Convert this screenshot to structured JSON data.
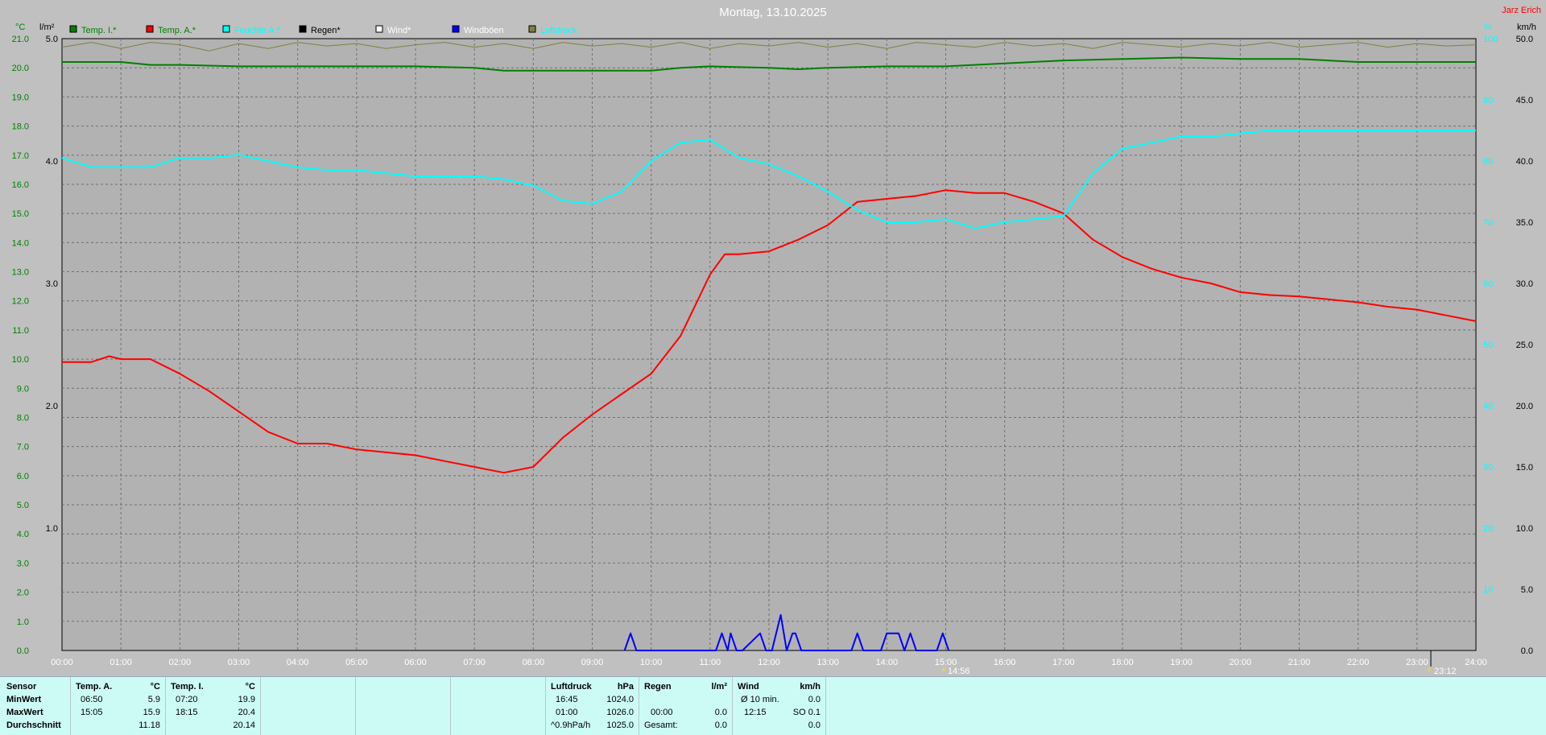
{
  "header": {
    "title": "Montag, 13.10.2025",
    "station": "Jarz Erich",
    "unit_temp": "°C",
    "unit_rain": "l/m²",
    "unit_humidity": "%",
    "unit_wind": "km/h",
    "marker_left": "14:56",
    "marker_right": "23:12"
  },
  "legend": [
    {
      "label": "Temp. I.*",
      "color": "#008000",
      "text_color": "#008000"
    },
    {
      "label": "Temp. A.*",
      "color": "#ff0000",
      "text_color": "#008000"
    },
    {
      "label": "Feuchte A.*",
      "color": "#00ffff",
      "text_color": "#00ffff"
    },
    {
      "label": "Regen*",
      "color": "#000000",
      "text_color": "#000000"
    },
    {
      "label": "Wind*",
      "color": "#ffffff",
      "text_color": "#ffffff"
    },
    {
      "label": "Windböen",
      "color": "#0000ff",
      "text_color": "#ffffff"
    },
    {
      "label": "Luftdruck",
      "color": "#808040",
      "text_color": "#00ffff"
    }
  ],
  "colors": {
    "background": "#c0c0c0",
    "plot_bg": "#b2b2b2",
    "temp_axis": "#008000",
    "humidity_axis": "#00ffff",
    "station_name": "#ff0000",
    "summary_bg": "#ccfbf6"
  },
  "chart_data": {
    "type": "line",
    "title": "Montag, 13.10.2025",
    "x_ticks": [
      "00:00",
      "01:00",
      "02:00",
      "03:00",
      "04:00",
      "05:00",
      "06:00",
      "07:00",
      "08:00",
      "09:00",
      "10:00",
      "11:00",
      "12:00",
      "13:00",
      "14:00",
      "15:00",
      "16:00",
      "17:00",
      "18:00",
      "19:00",
      "20:00",
      "21:00",
      "22:00",
      "23:00",
      "24:00"
    ],
    "xlim": [
      0,
      24
    ],
    "axes": {
      "temp": {
        "range": [
          0,
          21
        ],
        "ticks": [
          "0.0",
          "1.0",
          "2.0",
          "3.0",
          "4.0",
          "5.0",
          "6.0",
          "7.0",
          "8.0",
          "9.0",
          "10.0",
          "11.0",
          "12.0",
          "13.0",
          "14.0",
          "15.0",
          "16.0",
          "17.0",
          "18.0",
          "19.0",
          "20.0",
          "21.0"
        ]
      },
      "rain": {
        "range": [
          0,
          5
        ],
        "ticks": [
          "1.0",
          "2.0",
          "3.0",
          "4.0",
          "5.0"
        ]
      },
      "humidity": {
        "range": [
          0,
          100
        ],
        "ticks": [
          "10",
          "20",
          "30",
          "40",
          "50",
          "60",
          "70",
          "80",
          "90",
          "100"
        ]
      },
      "wind": {
        "range": [
          0,
          50
        ],
        "ticks": [
          "0.0",
          "5.0",
          "10.0",
          "15.0",
          "20.0",
          "25.0",
          "30.0",
          "35.0",
          "40.0",
          "45.0",
          "50.0"
        ]
      }
    },
    "grid": true,
    "series": [
      {
        "name": "Temp. I.",
        "axis": "temp",
        "color": "#008000",
        "x": [
          0,
          1,
          1.5,
          2,
          3,
          4,
          5,
          6,
          7,
          7.5,
          8,
          9,
          10,
          10.5,
          11,
          12,
          12.5,
          13,
          14,
          15,
          16,
          17,
          18,
          19,
          20,
          21,
          22,
          23,
          24
        ],
        "y": [
          20.2,
          20.2,
          20.1,
          20.1,
          20.05,
          20.05,
          20.05,
          20.05,
          20.0,
          19.9,
          19.9,
          19.9,
          19.9,
          20.0,
          20.05,
          20.0,
          19.95,
          20.0,
          20.05,
          20.05,
          20.15,
          20.25,
          20.3,
          20.35,
          20.3,
          20.3,
          20.2,
          20.2,
          20.2
        ]
      },
      {
        "name": "Temp. A.",
        "axis": "temp",
        "color": "#ff0000",
        "x": [
          0,
          0.5,
          0.8,
          1,
          1.5,
          2,
          2.5,
          3,
          3.5,
          4,
          4.5,
          5,
          5.5,
          6,
          6.5,
          7,
          7.5,
          8,
          8.5,
          9,
          9.5,
          10,
          10.5,
          11,
          11.25,
          11.5,
          12,
          12.5,
          13,
          13.5,
          14,
          14.5,
          15,
          15.5,
          16,
          16.5,
          17,
          17.5,
          18,
          18.5,
          19,
          19.5,
          20,
          20.5,
          21,
          21.5,
          22,
          22.5,
          23,
          23.5,
          24
        ],
        "y": [
          9.9,
          9.9,
          10.1,
          10.0,
          10.0,
          9.5,
          8.9,
          8.2,
          7.5,
          7.1,
          7.1,
          6.9,
          6.8,
          6.7,
          6.5,
          6.3,
          6.1,
          6.3,
          7.3,
          8.1,
          8.8,
          9.5,
          10.8,
          12.9,
          13.6,
          13.6,
          13.7,
          14.1,
          14.6,
          15.4,
          15.5,
          15.6,
          15.8,
          15.7,
          15.7,
          15.4,
          15.0,
          14.1,
          13.5,
          13.1,
          12.8,
          12.6,
          12.3,
          12.2,
          12.15,
          12.05,
          11.95,
          11.8,
          11.7,
          11.5,
          11.3
        ]
      },
      {
        "name": "Feuchte A.",
        "axis": "humidity",
        "color": "#00ffff",
        "x": [
          0,
          0.5,
          1,
          1.5,
          2,
          2.5,
          3,
          3.5,
          4,
          4.5,
          5,
          5.5,
          6,
          6.5,
          7,
          7.5,
          8,
          8.5,
          9,
          9.5,
          10,
          10.5,
          11,
          11.5,
          12,
          12.5,
          13,
          13.5,
          14,
          14.5,
          15,
          15.5,
          16,
          16.5,
          17,
          17.5,
          18,
          18.5,
          19,
          19.5,
          20,
          20.5,
          21,
          21.5,
          22,
          22.5,
          23,
          23.5,
          24
        ],
        "y": [
          80.5,
          79,
          79,
          79,
          80.5,
          80.5,
          81,
          80,
          79,
          78.5,
          78.5,
          78,
          77.5,
          77.5,
          77.5,
          77,
          76,
          73.5,
          73,
          75,
          80,
          83,
          83.5,
          80.5,
          79.5,
          77.5,
          75,
          72,
          70,
          70,
          70.5,
          69,
          70,
          70.5,
          71,
          78,
          82,
          83,
          84,
          84,
          84.5,
          85,
          85,
          85,
          85,
          85,
          85,
          85,
          85
        ]
      },
      {
        "name": "Windböen",
        "axis": "wind",
        "color": "#0000ff",
        "x": [
          9.55,
          9.65,
          9.75,
          11.1,
          11.2,
          11.3,
          11.35,
          11.45,
          11.55,
          11.85,
          11.95,
          12.05,
          12.2,
          12.3,
          12.4,
          12.45,
          12.55,
          12.65,
          13.4,
          13.5,
          13.6,
          13.9,
          14.0,
          14.2,
          14.3,
          14.4,
          14.5,
          14.6,
          14.85,
          14.95,
          15.05
        ],
        "y": [
          0,
          1.4,
          0,
          0,
          1.4,
          0,
          1.4,
          0,
          0,
          1.4,
          0,
          0,
          2.9,
          0,
          1.4,
          1.4,
          0,
          0,
          0,
          1.4,
          0,
          0,
          1.4,
          1.4,
          0,
          1.4,
          0,
          0,
          0,
          1.4,
          0
        ]
      },
      {
        "name": "Luftdruck",
        "axis": "rain",
        "color": "#808040",
        "note_scale": "top band",
        "x": [
          0,
          0.5,
          1,
          1.5,
          2,
          2.5,
          3,
          3.5,
          4,
          4.5,
          5,
          5.5,
          6,
          6.5,
          7,
          7.5,
          8,
          8.5,
          9,
          9.5,
          10,
          10.5,
          11,
          11.5,
          12,
          12.5,
          13,
          13.5,
          14,
          14.5,
          15,
          15.5,
          16,
          16.5,
          17,
          17.5,
          18,
          18.5,
          19,
          19.5,
          20,
          20.5,
          21,
          21.5,
          22,
          22.5,
          23,
          23.5,
          24
        ],
        "y": [
          4.93,
          4.97,
          4.92,
          4.97,
          4.95,
          4.9,
          4.96,
          4.92,
          4.97,
          4.94,
          4.96,
          4.92,
          4.95,
          4.97,
          4.93,
          4.96,
          4.92,
          4.97,
          4.94,
          4.96,
          4.93,
          4.97,
          4.92,
          4.96,
          4.94,
          4.97,
          4.93,
          4.96,
          4.92,
          4.97,
          4.95,
          4.93,
          4.97,
          4.94,
          4.96,
          4.92,
          4.97,
          4.95,
          4.93,
          4.96,
          4.94,
          4.97,
          4.93,
          4.95,
          4.97,
          4.93,
          4.96,
          4.94,
          4.95
        ]
      }
    ]
  },
  "summary": {
    "sensor_label": "Sensor",
    "row_labels": [
      "MinWert",
      "MaxWert",
      "Durchschnitt"
    ],
    "temp_a": {
      "title": "Temp. A.",
      "unit": "°C",
      "rows": [
        [
          "06:50",
          "5.9"
        ],
        [
          "15:05",
          "15.9"
        ],
        [
          "",
          "11.18"
        ]
      ]
    },
    "temp_i": {
      "title": "Temp. I.",
      "unit": "°C",
      "rows": [
        [
          "07:20",
          "19.9"
        ],
        [
          "18:15",
          "20.4"
        ],
        [
          "",
          "20.14"
        ]
      ]
    },
    "pressure": {
      "title": "Luftdruck",
      "unit": "hPa",
      "rows": [
        [
          "16:45",
          "1024.0"
        ],
        [
          "01:00",
          "1026.0"
        ],
        [
          "^0.9hPa/h",
          "1025.0"
        ]
      ]
    },
    "rain": {
      "title": "Regen",
      "unit": "l/m²",
      "rows": [
        [
          "",
          ""
        ],
        [
          "00:00",
          "0.0"
        ],
        [
          "Gesamt:",
          "0.0"
        ]
      ]
    },
    "wind": {
      "title": "Wind",
      "unit": "km/h",
      "rows": [
        [
          "Ø 10 min.",
          "0.0"
        ],
        [
          "12:15",
          "SO 0.1"
        ],
        [
          "",
          "0.0"
        ]
      ]
    }
  }
}
